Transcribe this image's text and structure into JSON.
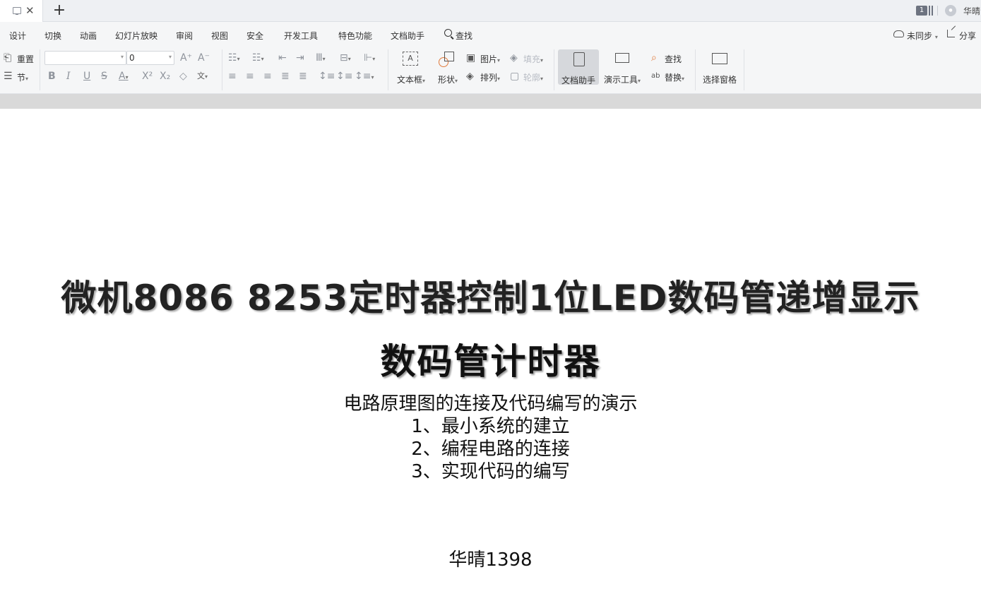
{
  "tabbar": {
    "close_glyph": "✕",
    "new_tab_glyph": "+",
    "page_count": "1",
    "user_name": "华晴"
  },
  "menu": {
    "items": [
      "设计",
      "切换",
      "动画",
      "幻灯片放映",
      "审阅",
      "视图",
      "安全",
      "开发工具",
      "特色功能",
      "文档助手"
    ],
    "search_label": "查找",
    "sync_label": "未同步",
    "share_label": "分享"
  },
  "ribbon": {
    "reset_label": "重置",
    "section_label": "节",
    "font_name": "",
    "font_size": "0",
    "textbox_label": "文本框",
    "shape_label": "形状",
    "picture_label": "图片",
    "fill_label": "填充",
    "arrange_label": "排列",
    "outline_label": "轮廓",
    "doc_assistant_label": "文档助手",
    "present_tools_label": "演示工具",
    "find_label": "查找",
    "replace_label": "替换",
    "selection_pane_label": "选择窗格"
  },
  "slide": {
    "title": "微机8086 8253定时器控制1位LED数码管递增显示",
    "subtitle": "数码管计时器",
    "lines": [
      "电路原理图的连接及代码编写的演示",
      "1、最小系统的建立",
      "2、编程电路的连接",
      "3、实现代码的编写"
    ],
    "author": "华晴1398"
  }
}
